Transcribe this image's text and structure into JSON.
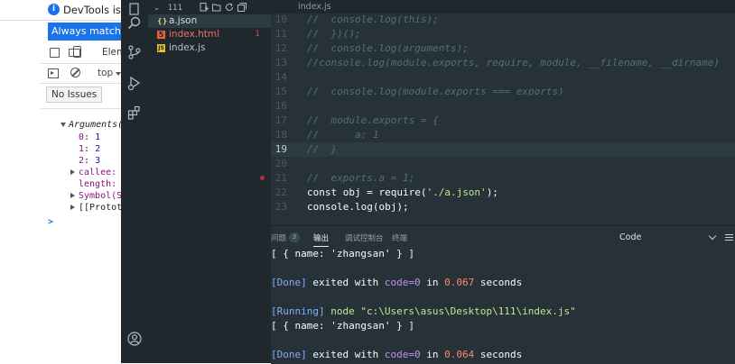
{
  "devtools": {
    "info_text": "DevTools is no",
    "match_button": "Always match Ch",
    "tab_elements": "Elem",
    "context": "top",
    "issues_button": "No Issues",
    "console": {
      "object_label": "Arguments(",
      "items": [
        {
          "key": "0",
          "value": "1"
        },
        {
          "key": "1",
          "value": "2"
        },
        {
          "key": "2",
          "value": "3"
        }
      ],
      "callee_label": "callee:",
      "length_label": "length:",
      "symbol_label": "Symbol(Sy",
      "prototype_label": "[[Prototy",
      "prompt": ">"
    }
  },
  "vscode": {
    "sidebar": {
      "folder": "111",
      "files": [
        {
          "name": "a.json",
          "badge": "{}",
          "badge_color": "#c9c97a",
          "color": "#d6dfe3",
          "count": "",
          "active": true
        },
        {
          "name": "index.html",
          "badge": "5",
          "badge_color": "#e8623a",
          "color": "#ef6d6d",
          "count": "1",
          "active": false
        },
        {
          "name": "index.js",
          "badge": "JS",
          "badge_color": "#e3c02e",
          "color": "#b6c3c9",
          "count": "",
          "active": false
        }
      ]
    },
    "editor_tab": "index.js",
    "code_lines": [
      {
        "num": "10",
        "text": "//  console.log(this);",
        "kind": "comment"
      },
      {
        "num": "11",
        "text": "//  })();",
        "kind": "comment"
      },
      {
        "num": "12",
        "text": "//  console.log(arguments);",
        "kind": "comment"
      },
      {
        "num": "13",
        "text": "//console.log(module.exports, require, module, __filename, __dirname)",
        "kind": "comment"
      },
      {
        "num": "14",
        "text": "",
        "kind": "comment"
      },
      {
        "num": "15",
        "text": "//  console.log(module.exports === exports)",
        "kind": "comment"
      },
      {
        "num": "16",
        "text": "",
        "kind": "comment"
      },
      {
        "num": "17",
        "text": "//  module.exports = {",
        "kind": "comment"
      },
      {
        "num": "18",
        "text": "//      a: 1",
        "kind": "comment"
      },
      {
        "num": "19",
        "text": "//  }",
        "kind": "comment"
      },
      {
        "num": "20",
        "text": "",
        "kind": "comment"
      },
      {
        "num": "21",
        "text": "//  exports.a = 1;",
        "kind": "comment"
      },
      {
        "num": "22",
        "text": "const obj = require(",
        "kind": "code",
        "string": "'./a.json'",
        "after": ");"
      },
      {
        "num": "23",
        "text": "console.log(obj);",
        "kind": "code"
      }
    ],
    "current_line": "19",
    "panel": {
      "tabs": [
        "问题",
        "输出",
        "调试控制台",
        "终端"
      ],
      "badge": "3",
      "active_tab": "输出",
      "select_value": "Code",
      "output_lines": [
        {
          "type": "result",
          "text": "[ { name: 'zhangsan' } ]"
        },
        {
          "type": "blank",
          "text": ""
        },
        {
          "type": "done",
          "label": "[Done]",
          "mid": " exited with ",
          "code": "code=0",
          "in": " in ",
          "time": "0.067",
          "unit": " seconds"
        },
        {
          "type": "blank",
          "text": ""
        },
        {
          "type": "running",
          "label": "[Running]",
          "text": " node \"c:\\Users\\asus\\Desktop\\111\\index.js\""
        },
        {
          "type": "result",
          "text": "[ { name: 'zhangsan' } ]"
        },
        {
          "type": "blank",
          "text": ""
        },
        {
          "type": "done",
          "label": "[Done]",
          "mid": " exited with ",
          "code": "code=0",
          "in": " in ",
          "time": "0.064",
          "unit": " seconds"
        }
      ]
    }
  },
  "colors": {
    "editor_bg": "#263238",
    "sidebar_bg": "#1e282d",
    "accent_blue": "#1a73e8",
    "comment": "#546e7a",
    "string": "#c3e88d"
  }
}
